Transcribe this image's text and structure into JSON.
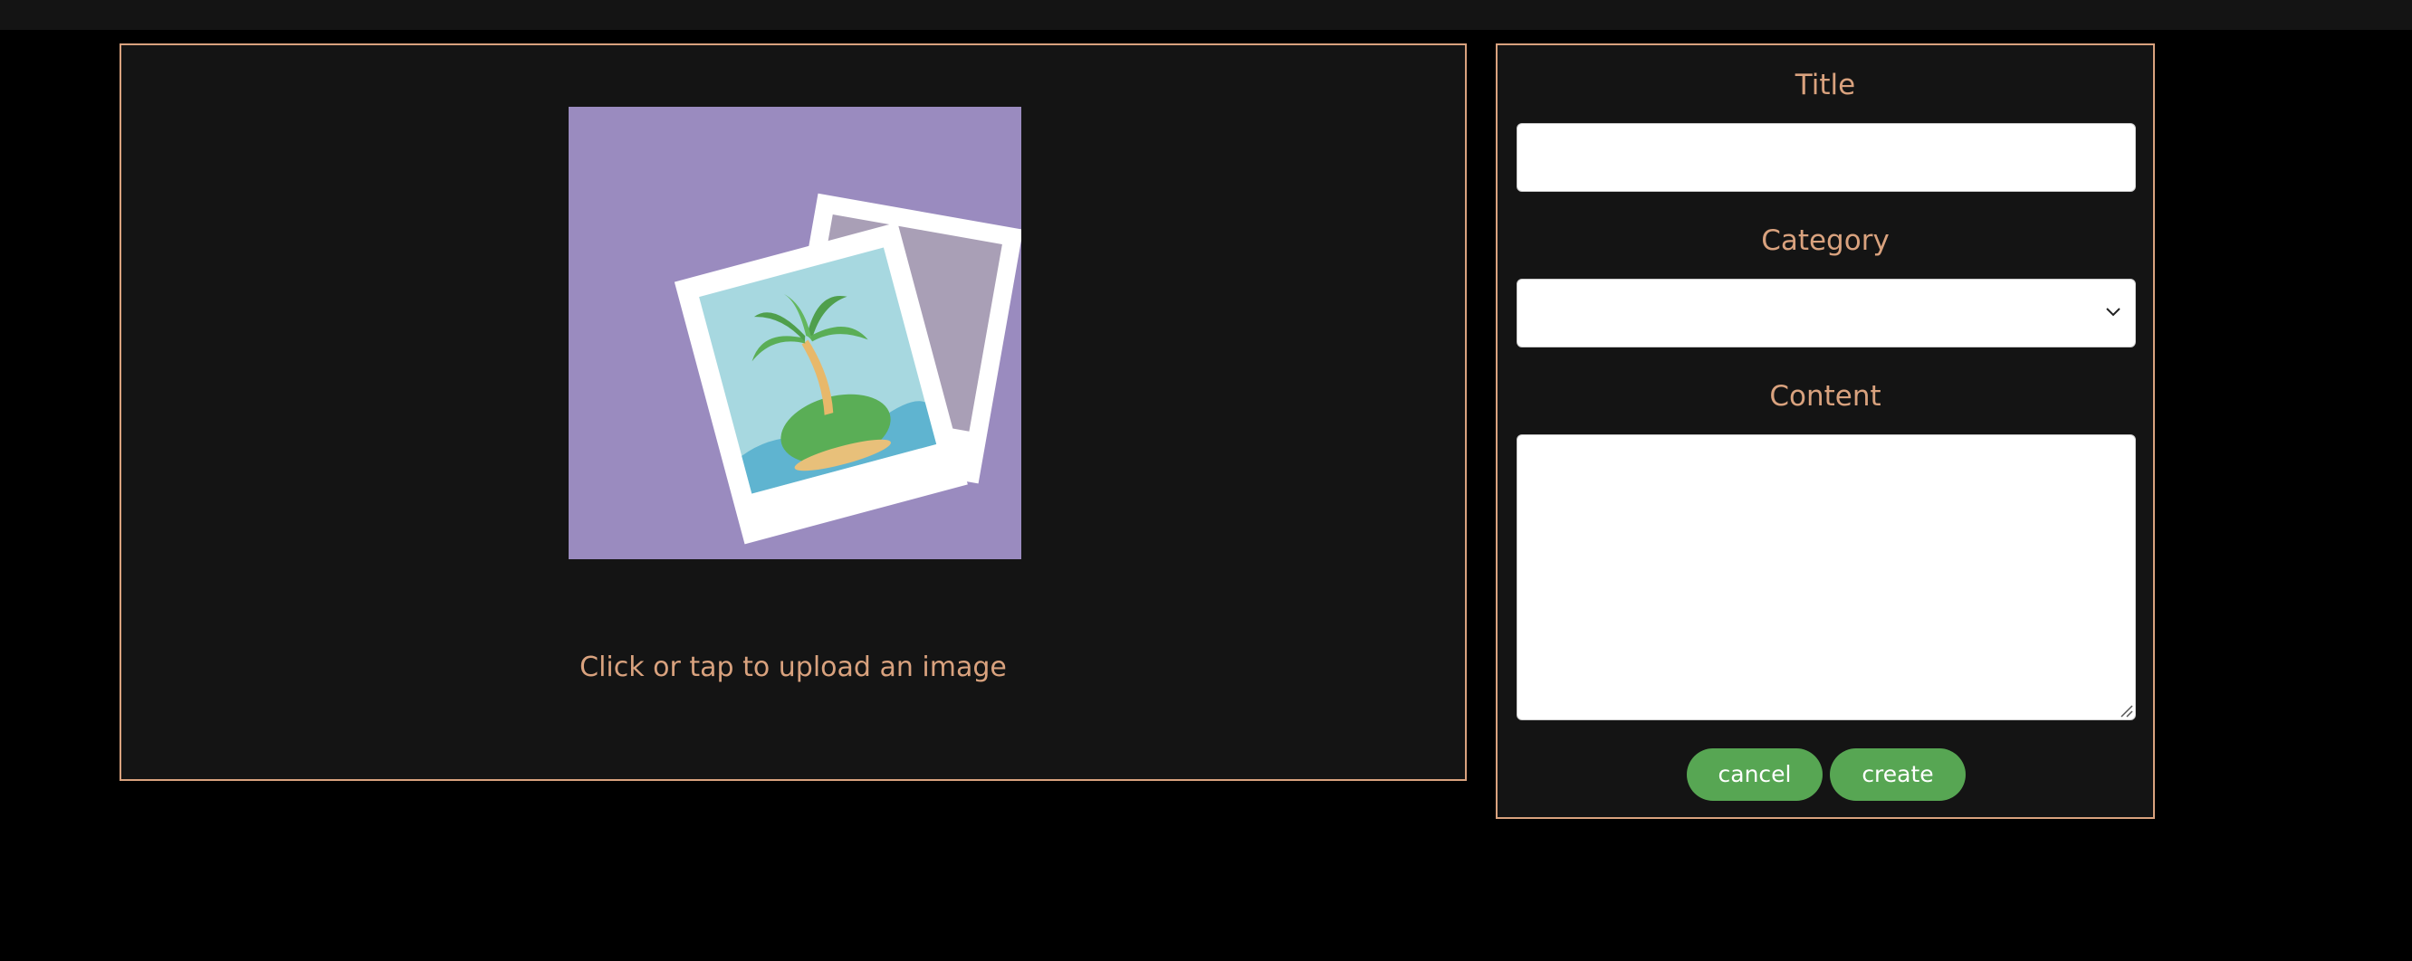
{
  "upload": {
    "caption": "Click or tap to upload an image",
    "placeholder_icon": "photo-placeholder-icon",
    "placeholder_bg": "#9a8bbf"
  },
  "form": {
    "title_label": "Title",
    "title_value": "",
    "category_label": "Category",
    "category_value": "",
    "content_label": "Content",
    "content_value": "",
    "cancel_label": "cancel",
    "create_label": "create"
  },
  "colors": {
    "accent": "#d9a27e",
    "button": "#57a653",
    "panel": "#141414",
    "background": "#000000"
  }
}
